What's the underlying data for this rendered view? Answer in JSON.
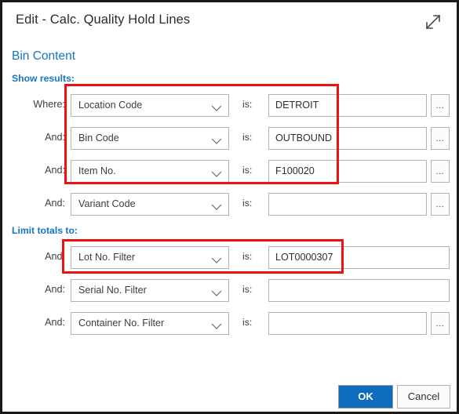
{
  "dialog": {
    "title": "Edit - Calc. Quality Hold Lines",
    "expand_icon": "expand-diagonal-arrows-icon"
  },
  "section": {
    "heading": "Bin Content"
  },
  "groups": {
    "show_results": {
      "label": "Show results:",
      "rows": [
        {
          "conjunction": "Where:",
          "field": "Location Code",
          "operator": "is:",
          "value": "DETROIT",
          "has_ellipsis": true
        },
        {
          "conjunction": "And:",
          "field": "Bin Code",
          "operator": "is:",
          "value": "OUTBOUND",
          "has_ellipsis": true
        },
        {
          "conjunction": "And:",
          "field": "Item No.",
          "operator": "is:",
          "value": "F100020",
          "has_ellipsis": true
        },
        {
          "conjunction": "And:",
          "field": "Variant Code",
          "operator": "is:",
          "value": "",
          "has_ellipsis": true
        }
      ]
    },
    "limit_totals": {
      "label": "Limit totals to:",
      "rows": [
        {
          "conjunction": "And:",
          "field": "Lot No. Filter",
          "operator": "is:",
          "value": "LOT0000307",
          "has_ellipsis": false
        },
        {
          "conjunction": "And:",
          "field": "Serial No. Filter",
          "operator": "is:",
          "value": "",
          "has_ellipsis": false
        },
        {
          "conjunction": "And:",
          "field": "Container No. Filter",
          "operator": "is:",
          "value": "",
          "has_ellipsis": true
        }
      ]
    }
  },
  "ellipsis_label": "...",
  "footer": {
    "ok_label": "OK",
    "cancel_label": "Cancel"
  },
  "annotations": {
    "highlight_color": "#ee1111"
  },
  "colors": {
    "accent_blue": "#1675c0",
    "primary_button": "#0f6cbd"
  }
}
